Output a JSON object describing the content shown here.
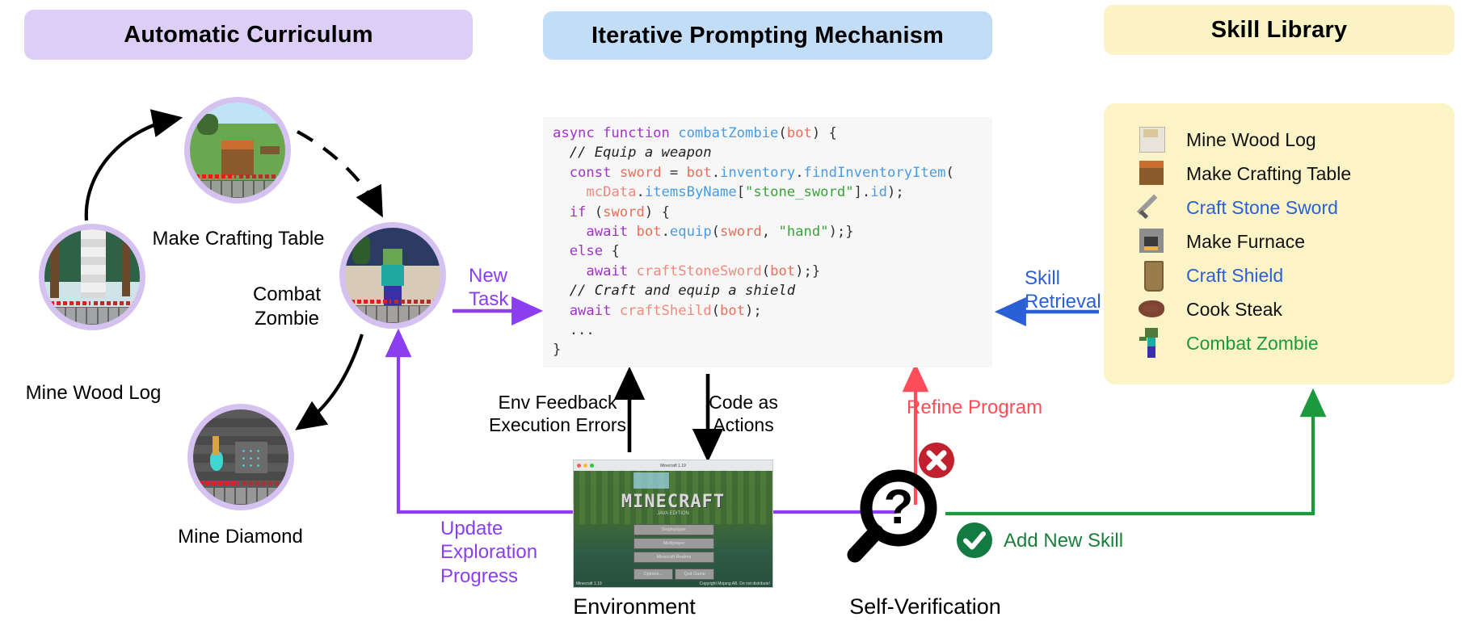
{
  "headers": {
    "curriculum": "Automatic Curriculum",
    "prompting": "Iterative Prompting Mechanism",
    "skill_library": "Skill Library"
  },
  "curriculum": {
    "nodes": [
      {
        "id": "mine-wood-log",
        "label": "Mine Wood Log"
      },
      {
        "id": "make-crafting-table",
        "label": "Make Crafting Table"
      },
      {
        "id": "combat-zombie",
        "label": "Combat\nZombie"
      },
      {
        "id": "mine-diamond",
        "label": "Mine Diamond"
      }
    ],
    "node_labels": {
      "wood": "Mine Wood Log",
      "table": "Make Crafting Table",
      "zombie_line1": "Combat",
      "zombie_line2": "Zombie",
      "diamond": "Mine Diamond"
    }
  },
  "code": {
    "language": "javascript",
    "lines": [
      "async function combatZombie(bot) {",
      "  // Equip a weapon",
      "  const sword = bot.inventory.findInventoryItem(",
      "    mcData.itemsByName[\"stone_sword\"].id);",
      "  if (sword) {",
      "    await bot.equip(sword, \"hand\");}",
      "  else {",
      "    await craftStoneSword(bot);}",
      "  // Craft and equip a shield",
      "  await craftSheild(bot);",
      "  ...",
      "}"
    ]
  },
  "skills": [
    {
      "icon": "wood-log-icon",
      "label": "Mine Wood  Log",
      "color": "#111111"
    },
    {
      "icon": "crafting-table-icon",
      "label": "Make Crafting Table",
      "color": "#111111"
    },
    {
      "icon": "stone-sword-icon",
      "label": "Craft Stone Sword",
      "color": "#2a5fd6"
    },
    {
      "icon": "furnace-icon",
      "label": "Make Furnace",
      "color": "#111111"
    },
    {
      "icon": "shield-icon",
      "label": "Craft Shield",
      "color": "#2a5fd6"
    },
    {
      "icon": "steak-icon",
      "label": "Cook Steak",
      "color": "#111111"
    },
    {
      "icon": "zombie-icon",
      "label": "Combat Zombie",
      "color": "#1a9a3c"
    }
  ],
  "flow_labels": {
    "new_task": "New\nTask",
    "new_task_l1": "New",
    "new_task_l2": "Task",
    "skill_retrieval_l1": "Skill",
    "skill_retrieval_l2": "Retrieval",
    "env_feedback_l1": "Env Feedback",
    "env_feedback_l2": "Execution Errors",
    "code_as_actions_l1": "Code as",
    "code_as_actions_l2": "Actions",
    "refine_program": "Refine Program",
    "update_l1": "Update",
    "update_l2": "Exploration",
    "update_l3": "Progress",
    "add_new_skill": "Add New Skill",
    "environment": "Environment",
    "self_verification": "Self-Verification"
  },
  "minecraft_window": {
    "title": "Minecraft 1.19",
    "logo": "MINECRAFT",
    "subtitle": "JAVA EDITION",
    "buttons": [
      "Singleplayer",
      "Multiplayer",
      "Minecraft Realms"
    ],
    "small_buttons": [
      "Options...",
      "Quit Game"
    ],
    "version": "Minecraft 1.19",
    "copyright": "Copyright Mojang AB. Do not distribute!"
  },
  "colors": {
    "curriculum_header": "#ddcef5",
    "prompting_header": "#c2ddf7",
    "skill_header": "#fbf3c4",
    "skill_panel": "#fcf4c6",
    "node_ring": "#d5c2f0",
    "purple_arrow": "#8b3ef0",
    "blue_arrow": "#2a5fd6",
    "red_arrow": "#ff4d59",
    "green_arrow": "#1a9a3c",
    "code_bg": "#f7f7f7"
  },
  "icons": {
    "error": "error-x-icon",
    "success": "success-check-icon",
    "magnifier": "magnifier-question-icon"
  }
}
